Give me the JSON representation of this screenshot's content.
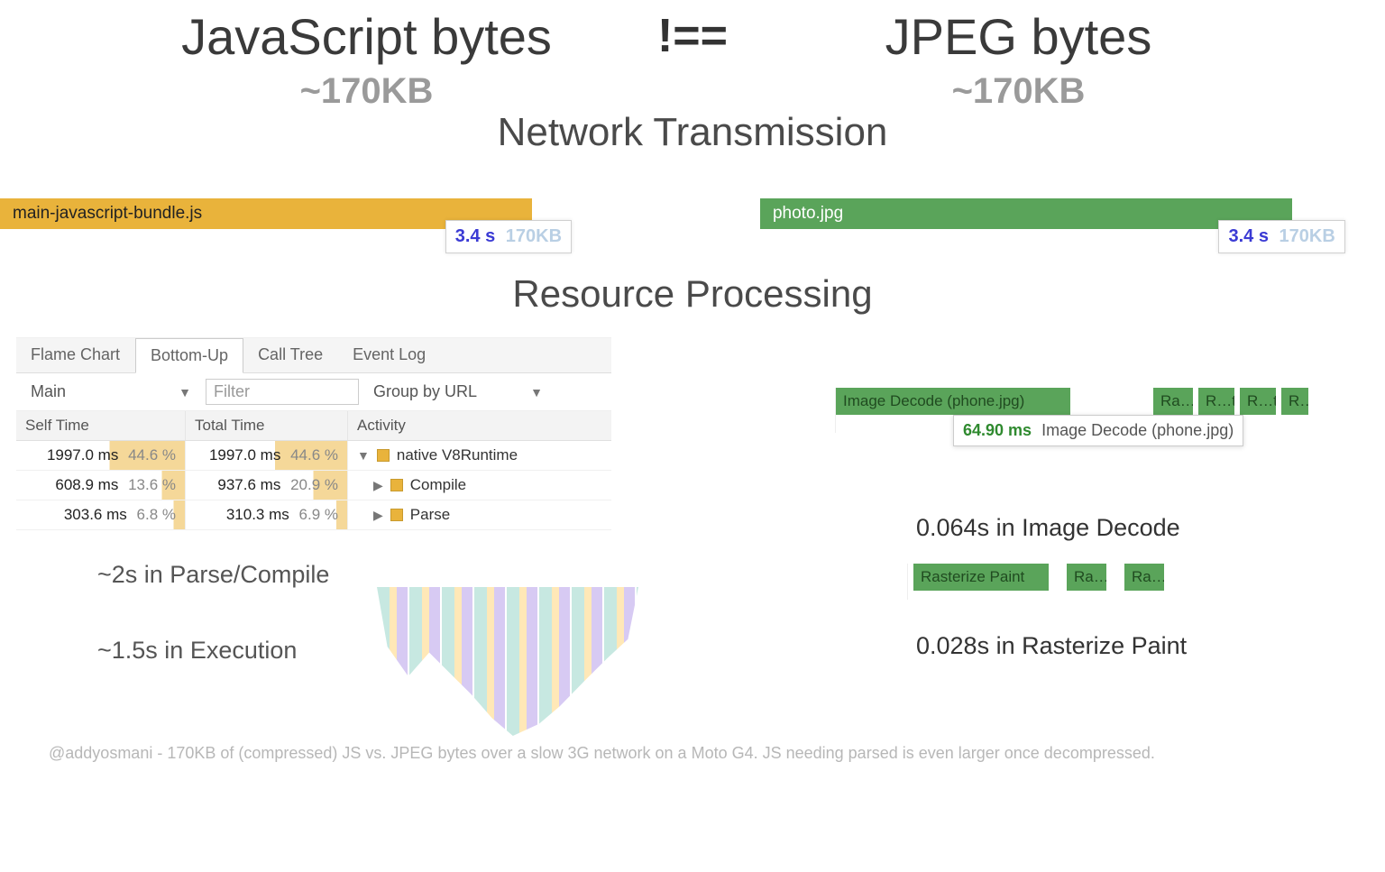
{
  "headline": {
    "left_title": "JavaScript bytes",
    "neq": "!==",
    "right_title": "JPEG bytes",
    "left_size": "~170KB",
    "right_size": "~170KB"
  },
  "section_network": "Network Transmission",
  "js_bar_label": "main-javascript-bundle.js",
  "jpg_bar_label": "photo.jpg",
  "badge_time": "3.4 s",
  "badge_kb": "170KB",
  "section_processing": "Resource Processing",
  "devtools": {
    "tabs": [
      "Flame Chart",
      "Bottom-Up",
      "Call Tree",
      "Event Log"
    ],
    "active_tab_index": 1,
    "thread_dropdown": "Main",
    "filter_placeholder": "Filter",
    "group_dropdown": "Group by URL",
    "cols": {
      "self": "Self Time",
      "total": "Total Time",
      "activity": "Activity"
    },
    "rows": [
      {
        "self_ms": "1997.0 ms",
        "self_pct": "44.6 %",
        "total_ms": "1997.0 ms",
        "total_pct": "44.6 %",
        "arrow": "▼",
        "activity": "native V8Runtime"
      },
      {
        "self_ms": "608.9 ms",
        "self_pct": "13.6 %",
        "total_ms": "937.6 ms",
        "total_pct": "20.9 %",
        "arrow": "▶",
        "activity": "Compile"
      },
      {
        "self_ms": "303.6 ms",
        "self_pct": "6.8 %",
        "total_ms": "310.3 ms",
        "total_pct": "6.9 %",
        "arrow": "▶",
        "activity": "Parse"
      }
    ]
  },
  "left_summary_parse": "~2s in Parse/Compile",
  "left_summary_exec": "~1.5s in Execution",
  "img_decode_block": "Image Decode (phone.jpg)",
  "raster_small": "Ra…t",
  "raster_short2": "R…t",
  "tooltip_ms": "64.90 ms",
  "tooltip_label": "Image Decode (phone.jpg)",
  "right_summary_decode": "0.064s in Image Decode",
  "raster_full": "Rasterize Paint",
  "right_summary_raster": "0.028s in Rasterize Paint",
  "footnote": "@addyosmani - 170KB of (compressed) JS vs. JPEG bytes over a slow 3G network on a Moto G4. JS needing parsed is even larger once decompressed."
}
